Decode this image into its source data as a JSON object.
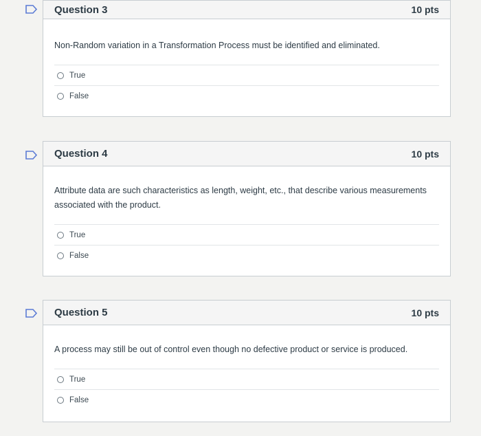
{
  "questions": [
    {
      "title": "Question 3",
      "points": "10 pts",
      "text": "Non-Random variation in a Transformation Process must be identified and eliminated.",
      "answers": [
        "True",
        "False"
      ]
    },
    {
      "title": "Question 4",
      "points": "10 pts",
      "text": "Attribute data are such characteristics as length, weight, etc., that describe various measurements associated with the product.",
      "answers": [
        "True",
        "False"
      ]
    },
    {
      "title": "Question 5",
      "points": "10 pts",
      "text": "A process may still be out of control even though no defective product or service is produced.",
      "answers": [
        "True",
        "False"
      ]
    }
  ],
  "colors": {
    "flag_outline": "#5b7bd5",
    "border": "#c7cdd1",
    "header_bg": "#f5f5f5"
  },
  "icons": {
    "flag": "bookmark-flag-icon"
  }
}
